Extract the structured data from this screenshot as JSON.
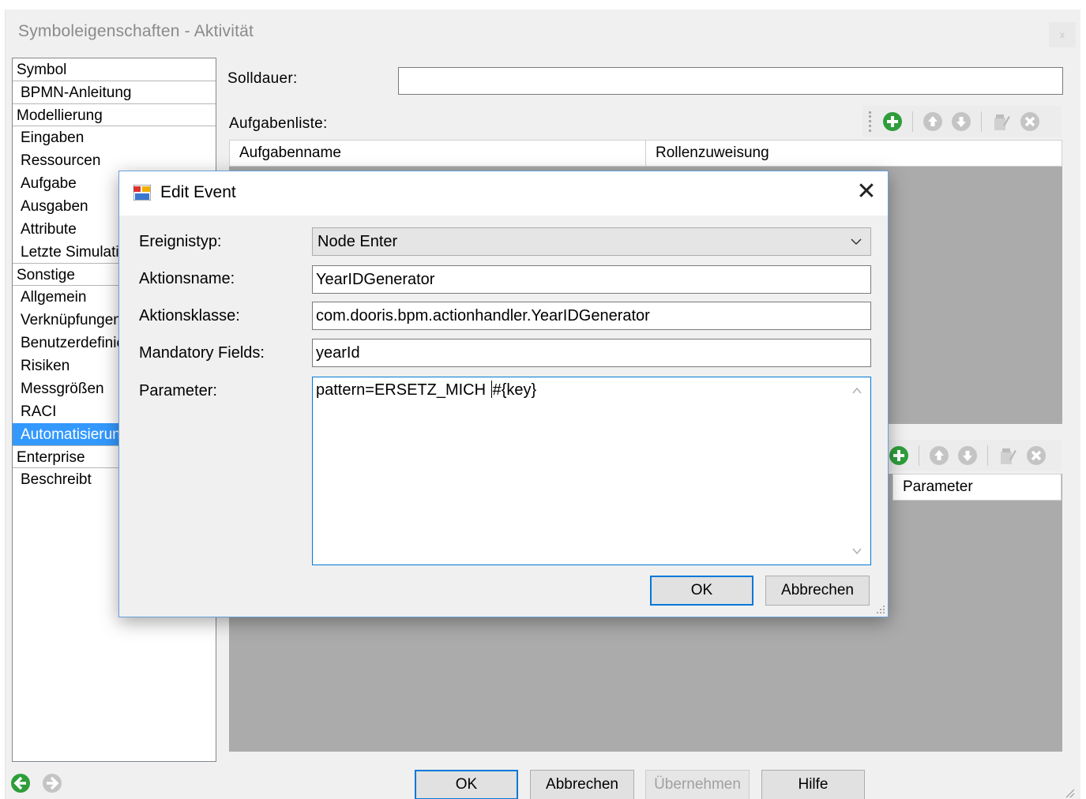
{
  "window": {
    "title": "Symboleigenschaften - Aktivität",
    "close_label": "x"
  },
  "sidebar": {
    "items": [
      {
        "label": "Symbol",
        "group": true
      },
      {
        "label": "BPMN-Anleitung",
        "group": false
      },
      {
        "label": "Modellierung",
        "group": true
      },
      {
        "label": "Eingaben",
        "group": false
      },
      {
        "label": "Ressourcen",
        "group": false
      },
      {
        "label": "Aufgabe",
        "group": false
      },
      {
        "label": "Ausgaben",
        "group": false
      },
      {
        "label": "Attribute",
        "group": false
      },
      {
        "label": "Letzte Simulation",
        "group": false
      },
      {
        "label": "Sonstige",
        "group": true
      },
      {
        "label": "Allgemein",
        "group": false
      },
      {
        "label": "Verknüpfungen",
        "group": false
      },
      {
        "label": "Benutzerdefiniert",
        "group": false
      },
      {
        "label": "Risiken",
        "group": false
      },
      {
        "label": "Messgrößen",
        "group": false
      },
      {
        "label": "RACI",
        "group": false
      },
      {
        "label": "Automatisierung",
        "group": false,
        "selected": true
      },
      {
        "label": "Enterprise",
        "group": true
      },
      {
        "label": "Beschreibt",
        "group": false
      }
    ]
  },
  "form": {
    "solldauer_label": "Solldauer:",
    "solldauer_value": "",
    "aufgabenliste_label": "Aufgabenliste:"
  },
  "task_grid": {
    "columns": [
      "Aufgabenname",
      "Rollenzuweisung"
    ]
  },
  "event_grid": {
    "columns": [
      "Parameter"
    ]
  },
  "footer": {
    "ok": "OK",
    "cancel": "Abbrechen",
    "apply": "Übernehmen",
    "help": "Hilfe"
  },
  "dialog": {
    "title": "Edit Event",
    "close_glyph": "✕",
    "fields": {
      "ereignistyp_label": "Ereignistyp:",
      "ereignistyp_value": "Node Enter",
      "aktionsname_label": "Aktionsname:",
      "aktionsname_value": "YearIDGenerator",
      "aktionsklasse_label": "Aktionsklasse:",
      "aktionsklasse_value": "com.dooris.bpm.actionhandler.YearIDGenerator",
      "mandatory_label": "Mandatory Fields:",
      "mandatory_value": "yearId",
      "parameter_label": "Parameter:",
      "parameter_value_before_caret": "pattern=ERSETZ_MICH ",
      "parameter_value_after_caret": "#{key}"
    },
    "ok": "OK",
    "cancel": "Abbrechen"
  },
  "icons": {
    "add": "add-circle-icon",
    "up": "move-up-icon",
    "down": "move-down-icon",
    "edit": "edit-icon",
    "delete": "delete-icon",
    "back": "back-arrow-icon",
    "forward": "forward-arrow-icon"
  },
  "colors": {
    "selection": "#3399ff",
    "add_green": "#2e9e3a",
    "focus_blue": "#0078d7"
  }
}
